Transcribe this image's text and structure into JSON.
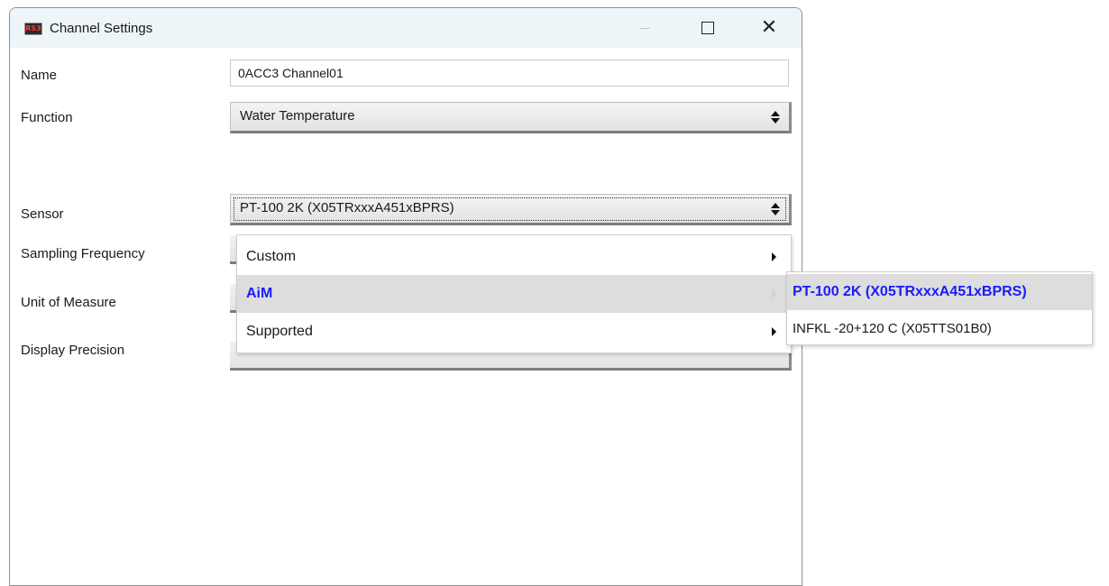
{
  "window": {
    "title": "Channel Settings",
    "app_icon_text": "RS3"
  },
  "form": {
    "name_label": "Name",
    "name_value": "0ACC3 Channel01",
    "function_label": "Function",
    "function_value": "Water Temperature",
    "sensor_label": "Sensor",
    "sensor_value": "PT-100 2K (X05TRxxxA451xBPRS)",
    "sampling_label": "Sampling Frequency",
    "unit_label": "Unit of Measure",
    "precision_label": "Display Precision"
  },
  "sensor_menu": {
    "items": [
      {
        "label": "Custom",
        "has_submenu": true
      },
      {
        "label": "AiM",
        "has_submenu": true,
        "active": true
      },
      {
        "label": "Supported",
        "has_submenu": true
      }
    ]
  },
  "aim_submenu": {
    "items": [
      {
        "label": "PT-100 2K (X05TRxxxA451xBPRS)",
        "selected": true
      },
      {
        "label": "INFKL -20+120 C (X05TTS01B0)"
      }
    ]
  },
  "colors": {
    "titlebar_bg": "#eef5f9",
    "highlight_text": "#1a1aff",
    "highlight_bg": "#dddddd"
  }
}
